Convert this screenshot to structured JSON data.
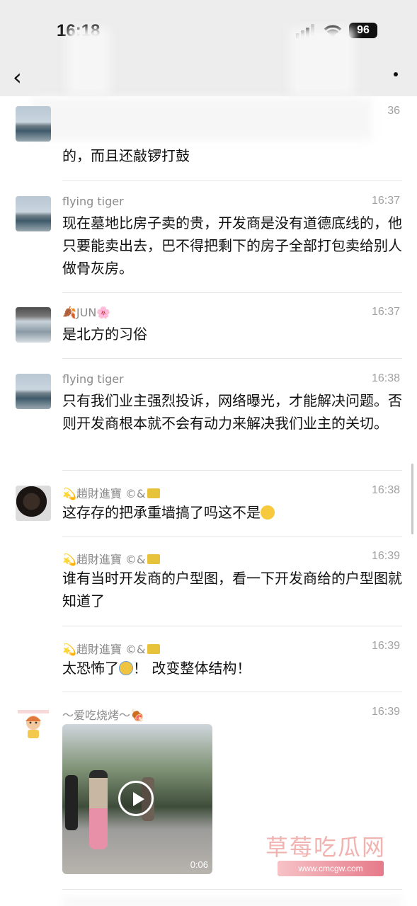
{
  "status": {
    "time": "16:18",
    "battery": "96"
  },
  "nav": {
    "back_icon": "‹"
  },
  "messages": [
    {
      "sender": "",
      "time": "36",
      "text": "的，而且还敲锣打鼓"
    },
    {
      "sender": "flying tiger",
      "time": "16:37",
      "text": "现在墓地比房子卖的贵，开发商是没有道德底线的，他只要能卖出去，巴不得把剩下的房子全部打包卖给别人做骨灰房。"
    },
    {
      "sender": "JUN",
      "time": "16:37",
      "text": "是北方的习俗"
    },
    {
      "sender": "flying tiger",
      "time": "16:38",
      "text": "只有我们业主强烈投诉，网络曝光，才能解决问题。否则开发商根本就不会有动力来解决我们业主的关切。"
    },
    {
      "sender": "趙財進寶",
      "time": "16:38",
      "text": "这存存的把承重墙搞了吗这不是"
    },
    {
      "sender": "趙財進寶",
      "time": "16:39",
      "text": "谁有当时开发商的户型图，看一下开发商给的户型图就知道了"
    },
    {
      "sender": "趙財進寶",
      "time": "16:39",
      "text": "太恐怖了",
      "text2": "！ 改变整体结构！"
    },
    {
      "sender": "～爱吃烧烤～",
      "time": "16:39",
      "duration": "0:06"
    }
  ],
  "watermark": {
    "text": "草莓吃瓜网",
    "url": "www.cmcgw.com"
  }
}
